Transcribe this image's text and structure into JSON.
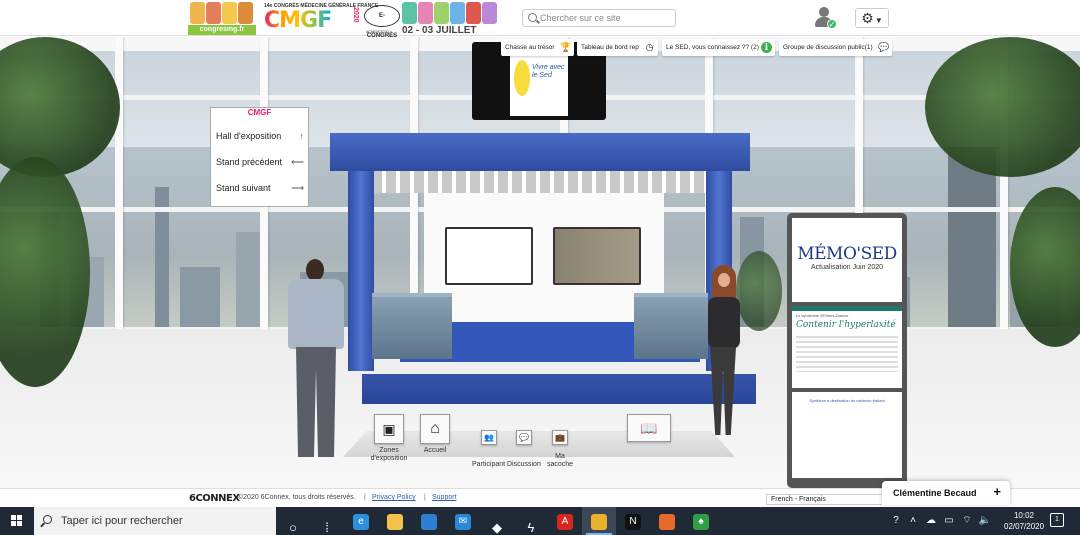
{
  "header": {
    "banner": {
      "site_url": "congresmg.fr",
      "event_line": "14e CONGRÈS MÉDECINE GÉNÉRALE FRANCE",
      "logo_text": "CMGF",
      "year": "2020",
      "format_badge": "E-CONGRÈS",
      "hashtag": "#CMGF2020",
      "dates": "02 - 03 JUILLET"
    },
    "search_placeholder": "Chercher sur ce site",
    "user_status_color": "#3cb878"
  },
  "badges": [
    {
      "label": "Chasse au trésor",
      "icon": "trophy-icon",
      "glyph": "🏆"
    },
    {
      "label": "Tableau de bord rep",
      "icon": "clock-icon",
      "glyph": "◷"
    },
    {
      "label": "Le SED, vous connaissez ?? (2)",
      "icon": "info-icon",
      "glyph": "ℹ"
    },
    {
      "label": "Groupe de discussion public(1)",
      "icon": "chat-bubbles-icon",
      "glyph": "💬"
    }
  ],
  "top_display": {
    "text": "Vivre avec le Sed"
  },
  "nav_panel": {
    "logo": "CMGF",
    "items": [
      {
        "label": "Hall d'exposition",
        "arrow": "↑"
      },
      {
        "label": "Stand précédent",
        "arrow": "⟵"
      },
      {
        "label": "Stand suivant",
        "arrow": "⟶"
      }
    ]
  },
  "poster": {
    "title": "MÉMO'SED",
    "subtitle": "Actualisation Juin 2020",
    "card_head": "Le syndrome d'Ehlers-Danlos",
    "card_title": "Contenir l'hyperlaxité",
    "note": "Synthèse à destination du médecin traitant"
  },
  "stand_toolbar": {
    "zones": "Zones d'exposition",
    "home": "Accueil",
    "participant": "Participant",
    "discussion": "Discussion",
    "bag": "Ma sacoche"
  },
  "footer": {
    "logo": "6CONNEX",
    "copyright": "©2020 6Connex, tous droits réservés.",
    "privacy": "Privacy Policy",
    "support": "Support",
    "separator": "|",
    "language": "French - Français"
  },
  "chat": {
    "name": "Clémentine Becaud",
    "plus": "+"
  },
  "taskbar": {
    "search_placeholder": "Taper ici pour rechercher",
    "apps": [
      {
        "name": "task-view-icon",
        "glyph": "○",
        "color": ""
      },
      {
        "name": "timeline-icon",
        "glyph": "⁞",
        "color": ""
      },
      {
        "name": "edge-icon",
        "glyph": "e",
        "color": "#2d8fdc"
      },
      {
        "name": "file-explorer-icon",
        "glyph": "",
        "color": "#f3c24a"
      },
      {
        "name": "store-icon",
        "glyph": "",
        "color": "#2d7fd3"
      },
      {
        "name": "mail-icon",
        "glyph": "✉",
        "color": "#2b88d8"
      },
      {
        "name": "dropbox-icon",
        "glyph": "◆",
        "color": ""
      },
      {
        "name": "winamp-icon",
        "glyph": "ϟ",
        "color": ""
      },
      {
        "name": "acrobat-icon",
        "glyph": "A",
        "color": "#d9261c"
      },
      {
        "name": "chrome-icon",
        "glyph": "",
        "color": "#e8b32a"
      },
      {
        "name": "netflix-icon",
        "glyph": "N",
        "color": "#111"
      },
      {
        "name": "firefox-icon",
        "glyph": "",
        "color": "#e86a2b"
      },
      {
        "name": "leaf-app-icon",
        "glyph": "♠",
        "color": "#2f9e44"
      }
    ],
    "time": "10:02",
    "date": "02/07/2020",
    "notification_count": "1"
  }
}
